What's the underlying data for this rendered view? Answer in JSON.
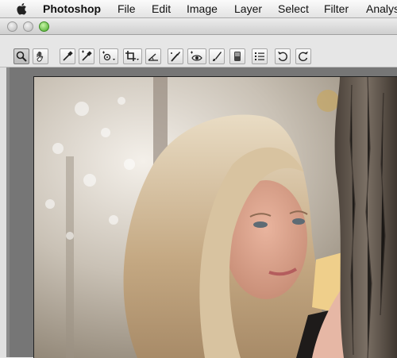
{
  "menu_bar": {
    "apple_icon": "apple-logo-icon",
    "items": [
      "Photoshop",
      "File",
      "Edit",
      "Image",
      "Layer",
      "Select",
      "Filter",
      "Analys"
    ]
  },
  "window": {
    "buttons": [
      "close",
      "minimize",
      "zoom"
    ],
    "colors": {
      "zoom": "#45a826",
      "inactive": "#b9b9b9"
    }
  },
  "toolbar": {
    "tools": [
      {
        "name": "zoom-tool",
        "icon": "magnifier-icon",
        "active": true
      },
      {
        "name": "hand-tool",
        "icon": "hand-icon"
      },
      {
        "name": "white-balance-tool",
        "icon": "eyedropper-icon"
      },
      {
        "name": "color-sampler-tool",
        "icon": "sampler-eyedropper-icon"
      },
      {
        "name": "targeted-adjustment-tool",
        "icon": "target-adjust-icon"
      },
      {
        "name": "crop-tool",
        "icon": "crop-icon"
      },
      {
        "name": "straighten-tool",
        "icon": "straighten-icon"
      },
      {
        "name": "spot-removal-tool",
        "icon": "spot-brush-icon"
      },
      {
        "name": "red-eye-tool",
        "icon": "red-eye-icon"
      },
      {
        "name": "adjustment-brush-tool",
        "icon": "brush-icon"
      },
      {
        "name": "graduated-filter-tool",
        "icon": "gradient-filter-icon"
      },
      {
        "name": "preferences-button",
        "icon": "list-icon"
      },
      {
        "name": "rotate-left-button",
        "icon": "rotate-ccw-icon"
      },
      {
        "name": "rotate-right-button",
        "icon": "rotate-cw-icon"
      }
    ]
  },
  "canvas": {
    "image": "portrait-photo",
    "background_color": "#767676"
  }
}
